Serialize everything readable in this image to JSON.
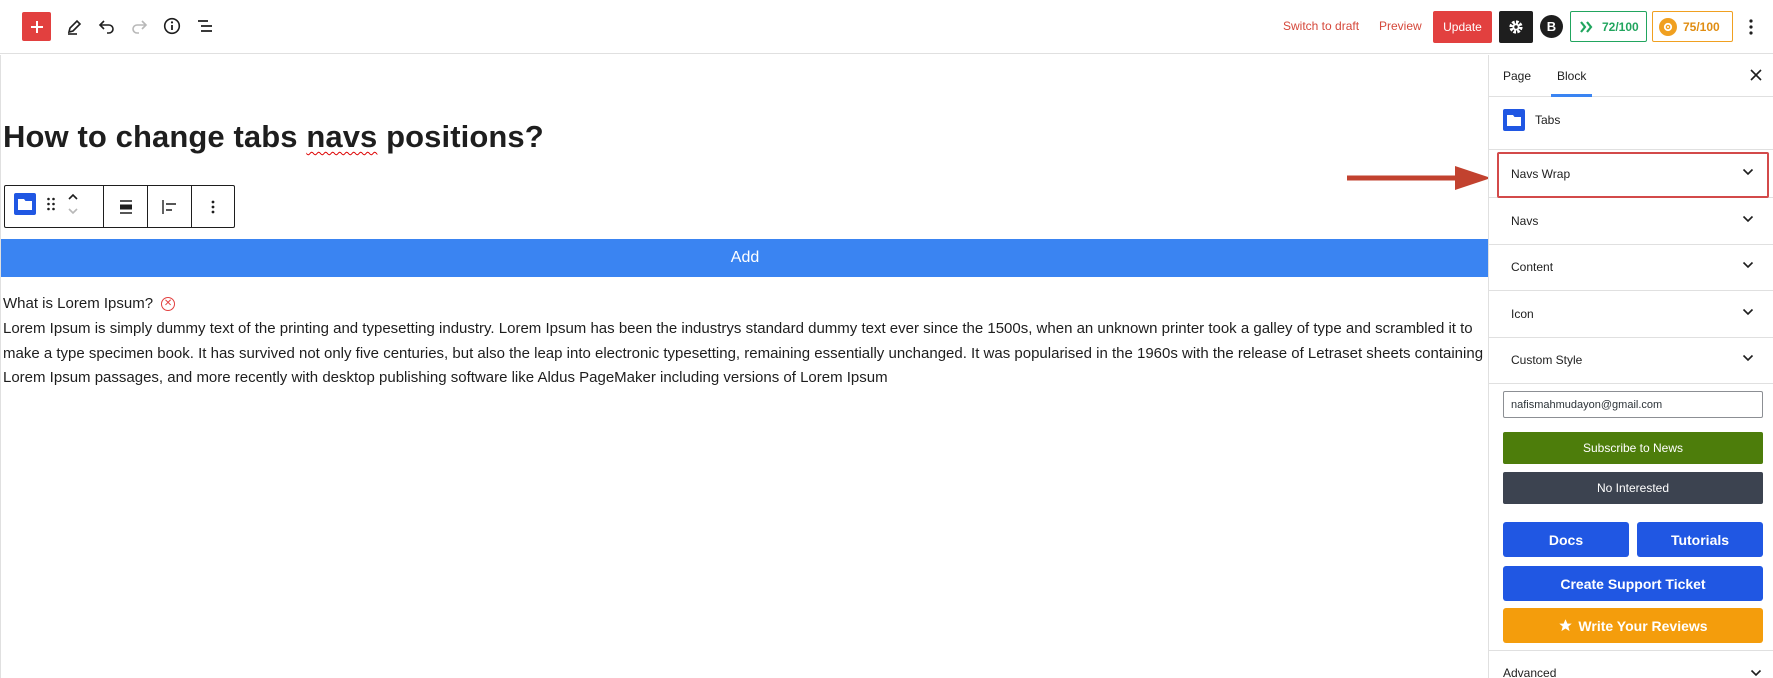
{
  "toolbar": {
    "add_icon": "plus-icon",
    "tools_icon": "pen-icon",
    "undo_icon": "undo-icon",
    "redo_icon": "redo-icon",
    "info_icon": "info-icon",
    "outline_icon": "list-view-icon",
    "switch_draft_label": "Switch to draft",
    "preview_label": "Preview",
    "update_label": "Update",
    "settings_icon": "gear-icon",
    "seo_badge_label": "B",
    "score_1": "72/100",
    "score_2": "75/100",
    "more_icon": "kebab-icon",
    "accent_color": "#e2403f"
  },
  "editor": {
    "title_part1": "How to change tabs ",
    "title_misspelled": "navs",
    "title_part2": " positions?",
    "add_button_label": "Add",
    "tab_title": "What is Lorem Ipsum?",
    "tab_content": "Lorem Ipsum is simply dummy text of the printing and typesetting industry. Lorem Ipsum has been the industrys standard dummy text ever since the 1500s, when an unknown printer took a galley of type and scrambled it to make a type specimen book. It has survived not only five centuries, but also the leap into electronic typesetting, remaining essentially unchanged. It was popularised in the 1960s with the release of Letraset sheets containing Lorem Ipsum passages, and more recently with desktop publishing software like Aldus PageMaker including versions of Lorem Ipsum",
    "add_bar_color": "#3a84f2"
  },
  "sidebar": {
    "tabs": [
      {
        "label": "Page"
      },
      {
        "label": "Block"
      }
    ],
    "block_name": "Tabs",
    "panels": [
      {
        "label": "Navs Wrap"
      },
      {
        "label": "Navs"
      },
      {
        "label": "Content"
      },
      {
        "label": "Icon"
      },
      {
        "label": "Custom Style"
      }
    ],
    "email_value": "nafismahmudayon@gmail.com",
    "subscribe_label": "Subscribe to News",
    "no_interest_label": "No Interested",
    "docs_label": "Docs",
    "tutorials_label": "Tutorials",
    "support_label": "Create Support Ticket",
    "review_label": "Write Your Reviews",
    "advanced_label": "Advanced"
  }
}
